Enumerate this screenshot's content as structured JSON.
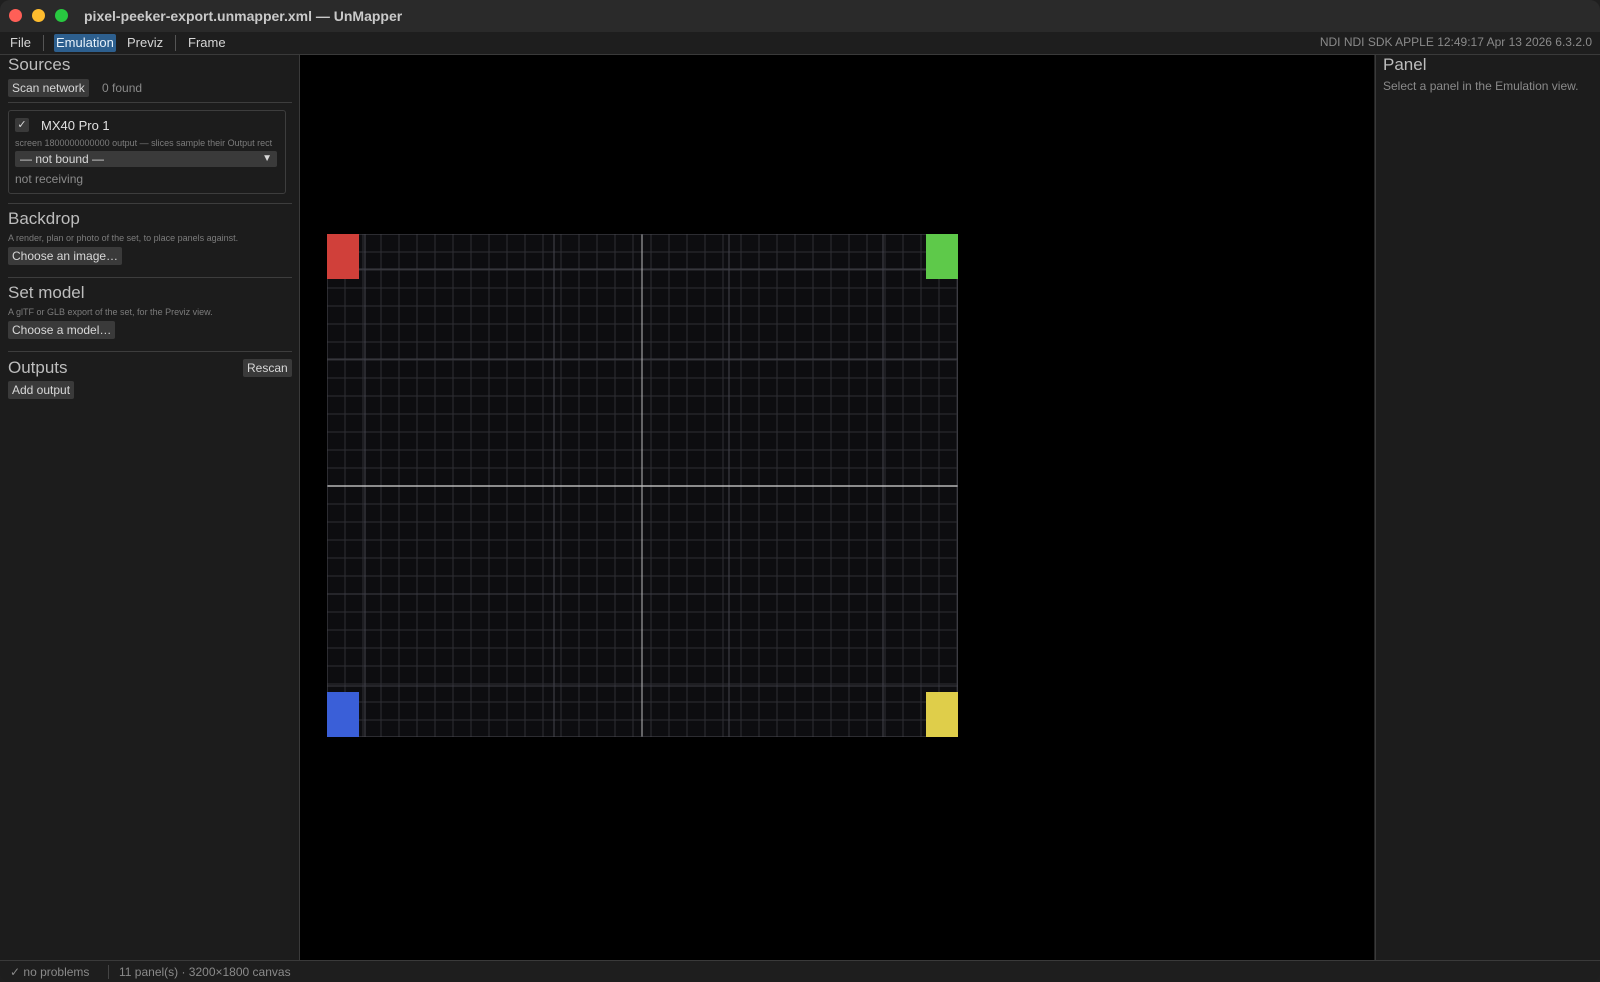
{
  "window": {
    "title": "pixel-peeker-export.unmapper.xml — UnMapper"
  },
  "menu": {
    "file": "File",
    "emulation": "Emulation",
    "previz": "Previz",
    "frame": "Frame",
    "status_right": "NDI NDI SDK APPLE 12:49:17 Apr 13 2026 6.3.2.0"
  },
  "sidebar": {
    "sources": {
      "title": "Sources",
      "scan_button": "Scan network",
      "found_text": "0 found",
      "card": {
        "checkbox_glyph": "✓",
        "name": "MX40 Pro 1",
        "detail": "screen 1800000000000 output — slices sample their Output rect",
        "dropdown_value": "— not bound —",
        "status": "not receiving"
      }
    },
    "backdrop": {
      "title": "Backdrop",
      "description": "A render, plan or photo of the set, to place panels against.",
      "button": "Choose an image…"
    },
    "set_model": {
      "title": "Set model",
      "description": "A glTF or GLB export of the set, for the Previz view.",
      "button": "Choose a model…"
    },
    "outputs": {
      "title": "Outputs",
      "rescan_button": "Rescan",
      "add_button": "Add output"
    }
  },
  "right_panel": {
    "title": "Panel",
    "hint": "Select a panel in the Emulation view."
  },
  "status": {
    "problems": "✓ no problems",
    "summary": "11 panel(s) · 3200×1800 canvas"
  },
  "canvas": {
    "corner_colors": {
      "top_left": "#d0403a",
      "top_right": "#5ec94a",
      "bottom_left": "#3a5fd8",
      "bottom_right": "#dfce4a"
    },
    "grid_color": "#2e2e34",
    "background": "#000000"
  }
}
